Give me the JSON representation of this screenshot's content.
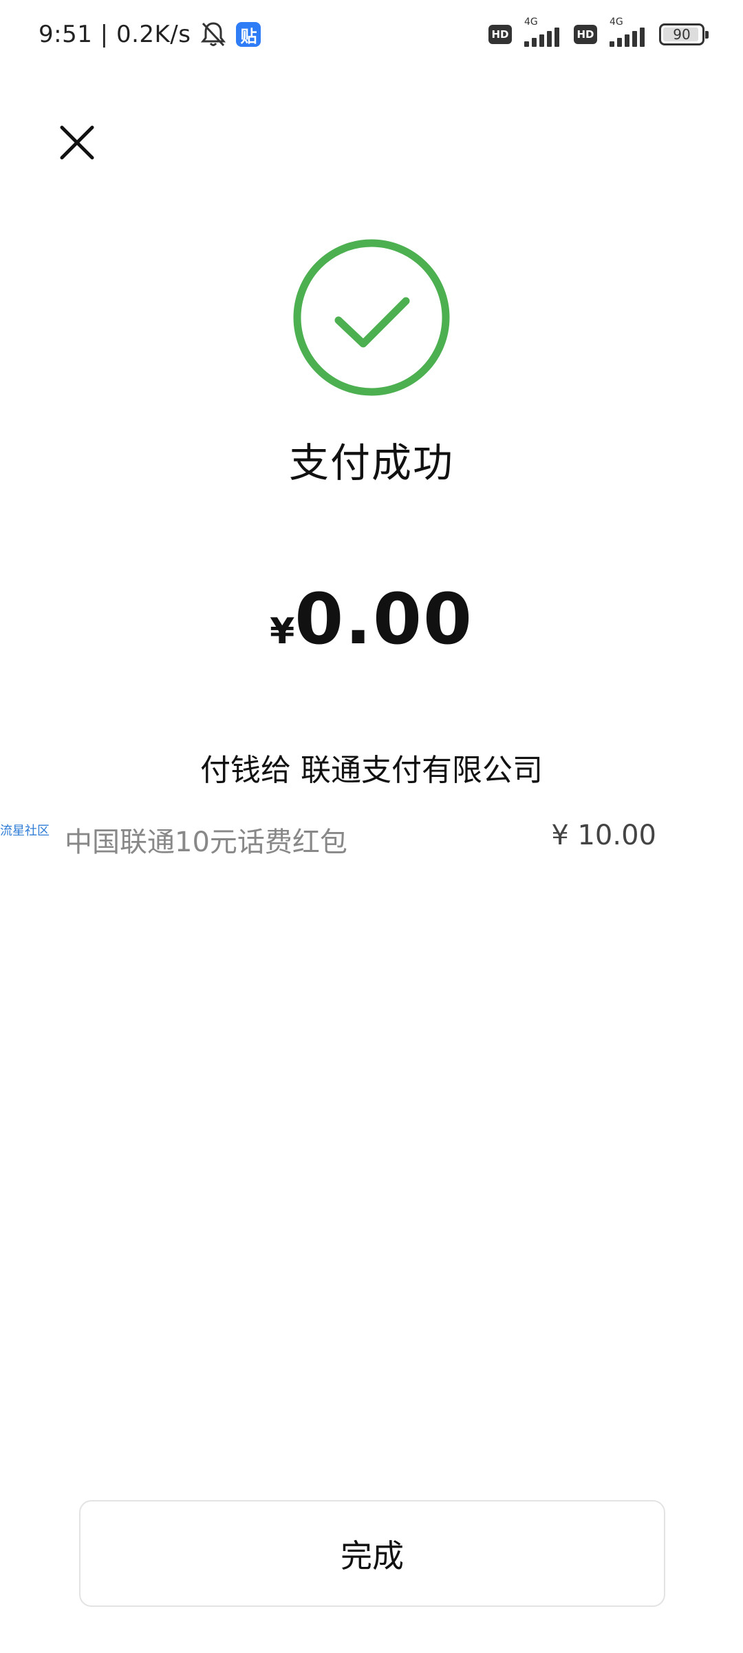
{
  "status_bar": {
    "time": "9:51",
    "net_speed": "0.2K/s",
    "app_badge": "贴",
    "hd_1": "HD",
    "net_1": "4G",
    "hd_2": "HD",
    "net_2": "4G",
    "battery": "90"
  },
  "header": {
    "close_icon": "close-icon"
  },
  "result": {
    "status_icon": "check-circle-icon",
    "title": "支付成功",
    "currency": "¥",
    "amount": "0.00",
    "payee": "付钱给 联通支付有限公司"
  },
  "detail": {
    "watermark": "流星社区",
    "item_name": "中国联通10元话费红包",
    "item_amount": "¥ 10.00"
  },
  "footer": {
    "done_label": "完成"
  },
  "colors": {
    "success_green": "#4CAF50",
    "text_primary": "#111111",
    "text_secondary": "#888888"
  }
}
